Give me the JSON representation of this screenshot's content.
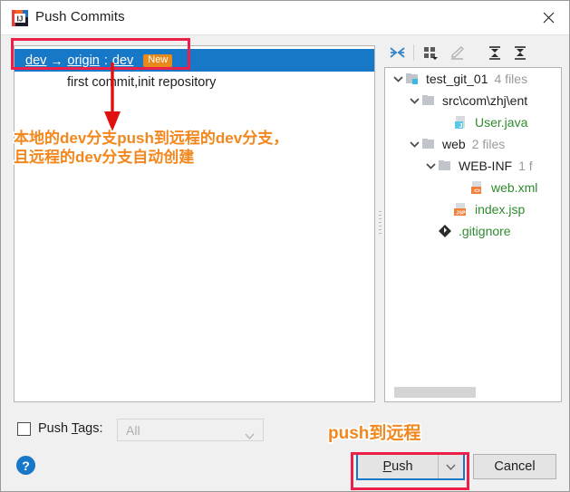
{
  "window": {
    "title": "Push Commits",
    "app_icon": "intellij-idea-icon",
    "close_icon": "close-icon"
  },
  "commits_panel": {
    "selected_row": {
      "local_branch": "dev",
      "arrow": "→",
      "remote": "origin",
      "separator": ":",
      "remote_branch": "dev",
      "badge": "New"
    },
    "commit_message": "first commit,init repository"
  },
  "splitter": {
    "name": "panel-splitter"
  },
  "tree_toolbar": {
    "buttons": [
      {
        "name": "collapse-diff-icon",
        "label": "Collapse",
        "enabled": true
      },
      {
        "name": "group-by-icon",
        "label": "Group By",
        "enabled": true
      },
      {
        "name": "edit-pencil-icon",
        "label": "Edit",
        "enabled": false
      },
      {
        "name": "expand-all-icon",
        "label": "Expand All",
        "enabled": true
      },
      {
        "name": "collapse-all-icon",
        "label": "Collapse All",
        "enabled": true
      }
    ]
  },
  "file_tree": {
    "nodes": [
      {
        "indent": 0,
        "expanded": true,
        "icon": "module-folder-icon",
        "label": "test_git_01",
        "count": "4 files",
        "color": "dark"
      },
      {
        "indent": 1,
        "expanded": true,
        "icon": "folder-icon",
        "label": "src\\com\\zhj\\ent",
        "count": "",
        "color": "dark"
      },
      {
        "indent": 3,
        "expanded": null,
        "icon": "java-file-icon",
        "label": "User.java",
        "count": "",
        "color": "green"
      },
      {
        "indent": 1,
        "expanded": true,
        "icon": "folder-icon",
        "label": "web",
        "count": "2 files",
        "color": "dark"
      },
      {
        "indent": 2,
        "expanded": true,
        "icon": "folder-icon",
        "label": "WEB-INF",
        "count": "1 f",
        "color": "dark"
      },
      {
        "indent": 4,
        "expanded": null,
        "icon": "xml-file-icon",
        "label": "web.xml",
        "count": "",
        "color": "green"
      },
      {
        "indent": 3,
        "expanded": null,
        "icon": "jsp-file-icon",
        "label": "index.jsp",
        "count": "",
        "color": "green"
      },
      {
        "indent": 2,
        "expanded": null,
        "icon": "git-file-icon",
        "label": ".gitignore",
        "count": "",
        "color": "green"
      }
    ],
    "hscrollbar": "horizontal-scrollbar"
  },
  "bottom": {
    "push_tags_label_pre": "Push ",
    "push_tags_mnemonic": "T",
    "push_tags_label_post": "ags:",
    "tags_value": "All",
    "tags_enabled": false,
    "help_glyph": "?",
    "push_label_pre": "",
    "push_mnemonic": "P",
    "push_label_post": "ush",
    "push_dropdown_icon": "chevron-down-icon",
    "cancel_label": "Cancel"
  },
  "annotations": {
    "branch_text_line1": "本地的dev分支push到远程的dev分支，",
    "branch_text_line2": "且远程的dev分支自动创建",
    "push_text": "push到远程",
    "rect_color": "#ec1f4b",
    "text_color": "#f2871e",
    "arrow_color": "#e01010"
  },
  "colors": {
    "selection_blue": "#1878c8",
    "badge_orange": "#e88a1a",
    "tree_green": "#2f8b2f",
    "dialog_bg": "#f0f0f0"
  }
}
